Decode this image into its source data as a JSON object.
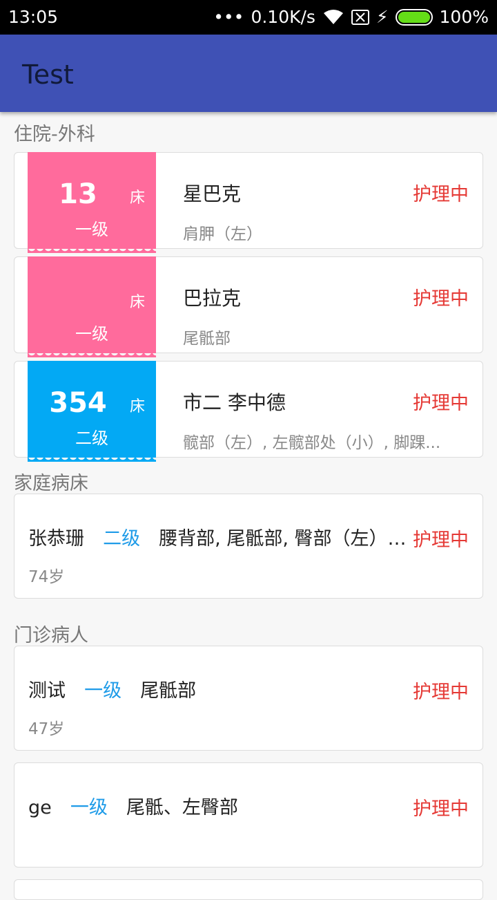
{
  "statusbar": {
    "time": "13:05",
    "dots": "•••",
    "speed": "0.10K/s",
    "battery": "100%"
  },
  "appbar": {
    "title": "Test"
  },
  "sections": {
    "inpatient": "住院-外科",
    "home": "家庭病床",
    "outpatient": "门诊病人"
  },
  "inpatients": [
    {
      "bed": "13",
      "bed_unit": "床",
      "level": "一级",
      "name": "星巴克",
      "parts": "肩胛（左）",
      "status": "护理中"
    },
    {
      "bed": "",
      "bed_unit": "床",
      "level": "一级",
      "name": "巴拉克",
      "parts": "尾骶部",
      "status": "护理中"
    },
    {
      "bed": "354",
      "bed_unit": "床",
      "level": "二级",
      "name": "市二 李中德",
      "parts": "髋部（左）, 左髋部处（小）, 脚踝...",
      "status": "护理中"
    }
  ],
  "home_patients": [
    {
      "name": "张恭珊",
      "level": "二级",
      "parts": "腰背部, 尾骶部, 臀部（左）,...",
      "age": "74岁",
      "status": "护理中"
    }
  ],
  "outpatients": [
    {
      "name": "测试",
      "level": "一级",
      "parts": "尾骶部",
      "age": "47岁",
      "status": "护理中"
    },
    {
      "name": "ge",
      "level": "一级",
      "parts": "尾骶、左臀部",
      "age": "",
      "status": "护理中"
    }
  ],
  "colors": {
    "appbar": "#3f51b5",
    "pink_tag": "#ff6b9c",
    "blue_tag": "#03a9f4",
    "status": "#e53935",
    "level": "#1e9be8"
  }
}
